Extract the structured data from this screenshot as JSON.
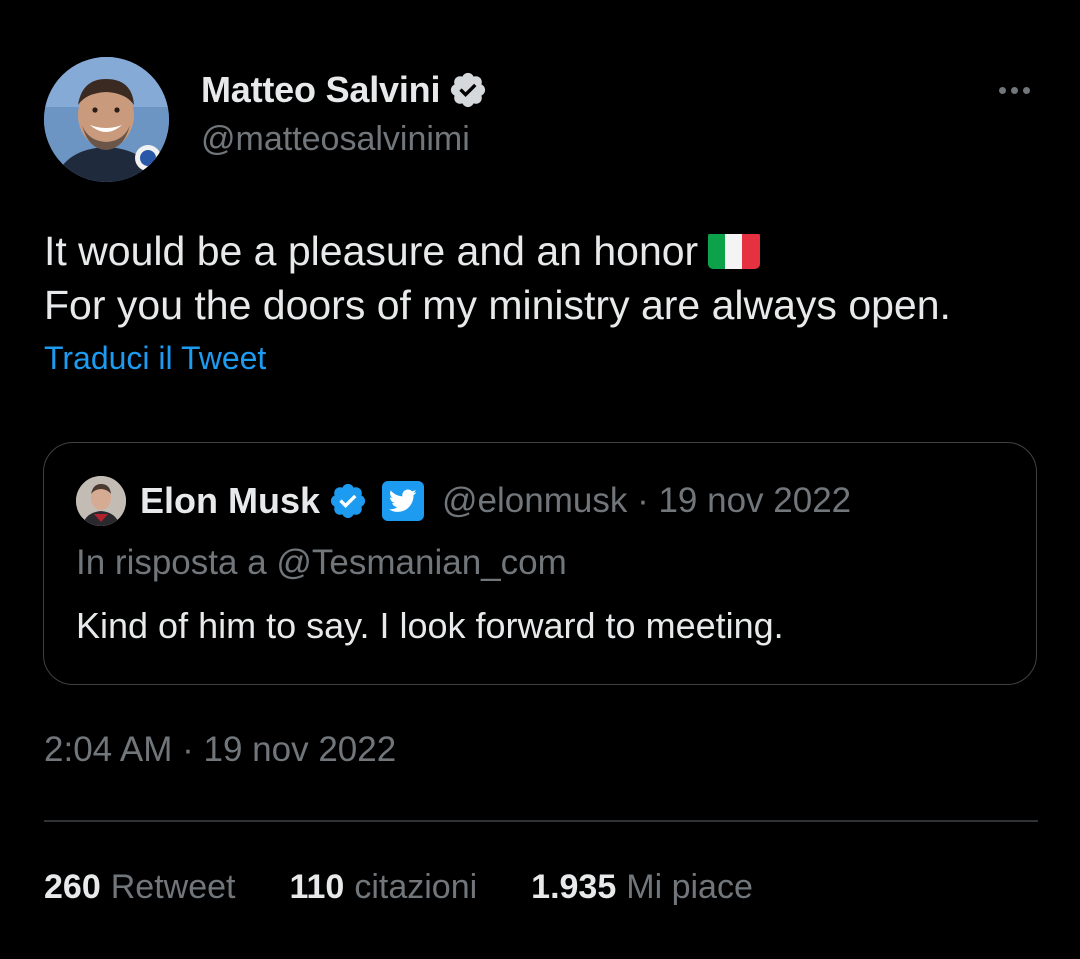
{
  "tweet": {
    "author": {
      "name": "Matteo Salvini",
      "handle": "@matteosalvinimi",
      "avatar_icon": "user-avatar-photo",
      "verified_icon": "verified-badge-icon"
    },
    "more_icon": "more-options-icon",
    "text_lines": [
      "It would be a pleasure and an honor",
      "For you the doors of my ministry are always open."
    ],
    "flag_icon": "italy-flag-emoji",
    "translate_label": "Traduci il Tweet",
    "quoted": {
      "name": "Elon Musk",
      "avatar_icon": "user-avatar-photo",
      "verified_icon": "verified-badge-icon",
      "affiliate_icon": "twitter-bird-icon",
      "handle_date": "@elonmusk · 19 nov 2022",
      "reply_prefix": "In risposta a",
      "reply_mention": "@Tesmanian_com",
      "text": "Kind of him to say. I look forward to meeting."
    },
    "timestamp": "2:04 AM · 19 nov 2022",
    "stats": [
      {
        "count": "260",
        "label": "Retweet"
      },
      {
        "count": "110",
        "label": "citazioni"
      },
      {
        "count": "1.935",
        "label": "Mi piace"
      }
    ]
  },
  "colors": {
    "background": "#000000",
    "primary_text": "#e7e9ea",
    "secondary_text": "#71767b",
    "accent": "#1d9bf0",
    "border": "#3e4144"
  }
}
